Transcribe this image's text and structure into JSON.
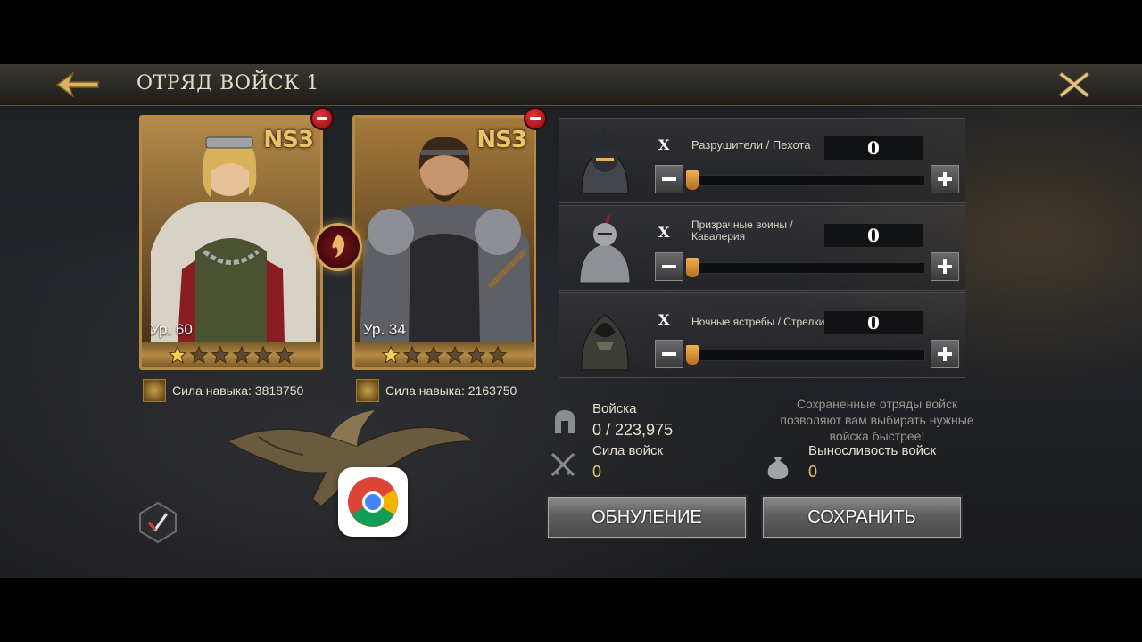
{
  "header": {
    "title": "ОТРЯД ВОЙСК 1",
    "back_icon": "arrow-left-icon",
    "close_icon": "close-icon"
  },
  "heroes": [
    {
      "badge": "NS3",
      "level": "Ур. 60",
      "stars_filled": 1,
      "stars_total": 6,
      "skill_power": "Сила навыка: 3818750"
    },
    {
      "badge": "NS3",
      "level": "Ур. 34",
      "stars_filled": 1,
      "stars_total": 6,
      "skill_power": "Сила навыка: 2163750"
    }
  ],
  "troops": [
    {
      "multiplier": "X",
      "name": "Разрушители / Пехота",
      "count": "0",
      "slider_fraction": 0
    },
    {
      "multiplier": "X",
      "name": "Призрачные воины / Кавалерия",
      "count": "0",
      "slider_fraction": 0
    },
    {
      "multiplier": "X",
      "name": "Ночные ястребы / Стрелки",
      "count": "0",
      "slider_fraction": 0
    }
  ],
  "stats": {
    "troops_label": "Войска",
    "troops_value": "0 / 223,975",
    "power_label": "Сила войск",
    "power_value": "0",
    "stamina_label": "Выносливость войск",
    "stamina_value": "0"
  },
  "hint": "Сохраненные отряды войск позволяют вам выбирать нужные войска быстрее!",
  "buttons": {
    "reset": "ОБНУЛЕНИЕ",
    "save": "СОХРАНИТЬ"
  },
  "colors": {
    "gold": "#e9c46a",
    "card_border": "#b38b45",
    "remove_red": "#d92b31",
    "slider_orange": "#e39a3c"
  }
}
